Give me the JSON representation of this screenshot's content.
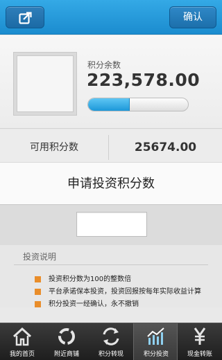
{
  "header": {
    "back_icon": "edit-share-icon",
    "confirm_label": "确认"
  },
  "balance": {
    "label": "积分余数",
    "value": "223,578.00",
    "progress_fraction": 0.42,
    "progress_color": "#1d98d9"
  },
  "available": {
    "label": "可用积分数",
    "value": "25674.00"
  },
  "dialog": {
    "title": "申请投资积分数",
    "input_value": ""
  },
  "info": {
    "title": "投资说明",
    "items": [
      "投资积分数为100的整数倍",
      "平台承诺保本投资，投资回报按每年实际收益计算",
      "积分投资一经确认，永不撤销"
    ],
    "bullet_color": "#e98d2a"
  },
  "nav": {
    "items": [
      {
        "label": "我的首页",
        "icon": "home-icon"
      },
      {
        "label": "附近商铺",
        "icon": "refresh-ring-icon"
      },
      {
        "label": "积分转现",
        "icon": "swap-arrows-icon"
      },
      {
        "label": "积分投资",
        "icon": "chart-icon"
      },
      {
        "label": "现金转账",
        "icon": "yen-icon"
      }
    ],
    "active_index": 3
  }
}
